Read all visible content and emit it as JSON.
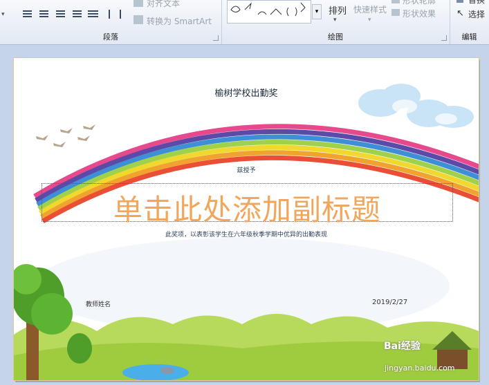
{
  "ribbon": {
    "paragraph_group_label": "段落",
    "drawing_group_label": "绘图",
    "editing_group_label": "编辑",
    "align_text_label": "对齐文本",
    "smartart_label": "转换为 SmartArt",
    "arrange_label": "排列",
    "quick_styles_label": "快速样式",
    "shape_outline_label": "形状轮廓",
    "shape_effects_label": "形状效果",
    "replace_label": "替换",
    "select_label": "选择"
  },
  "slide": {
    "title": "榆树学校出勤奖",
    "presented_to": "兹授予",
    "subtitle_placeholder": "单击此处添加副标题",
    "description": "此奖项，以表彰该学生在六年级秋季学期中优异的出勤表现",
    "teacher_name": "教师姓名",
    "date": "2019/2/27"
  },
  "watermark": {
    "brand": "Bai经验",
    "url": "jingyan.baidu.com"
  },
  "colors": {
    "ribbon_bg": "#e2e9f3",
    "subtitle": "#f2a65c",
    "rainbow": [
      "#e64a8c",
      "#5b4aa8",
      "#3f8fd6",
      "#9fd24a",
      "#f0d82f",
      "#f0a32f",
      "#ea4f36"
    ]
  }
}
